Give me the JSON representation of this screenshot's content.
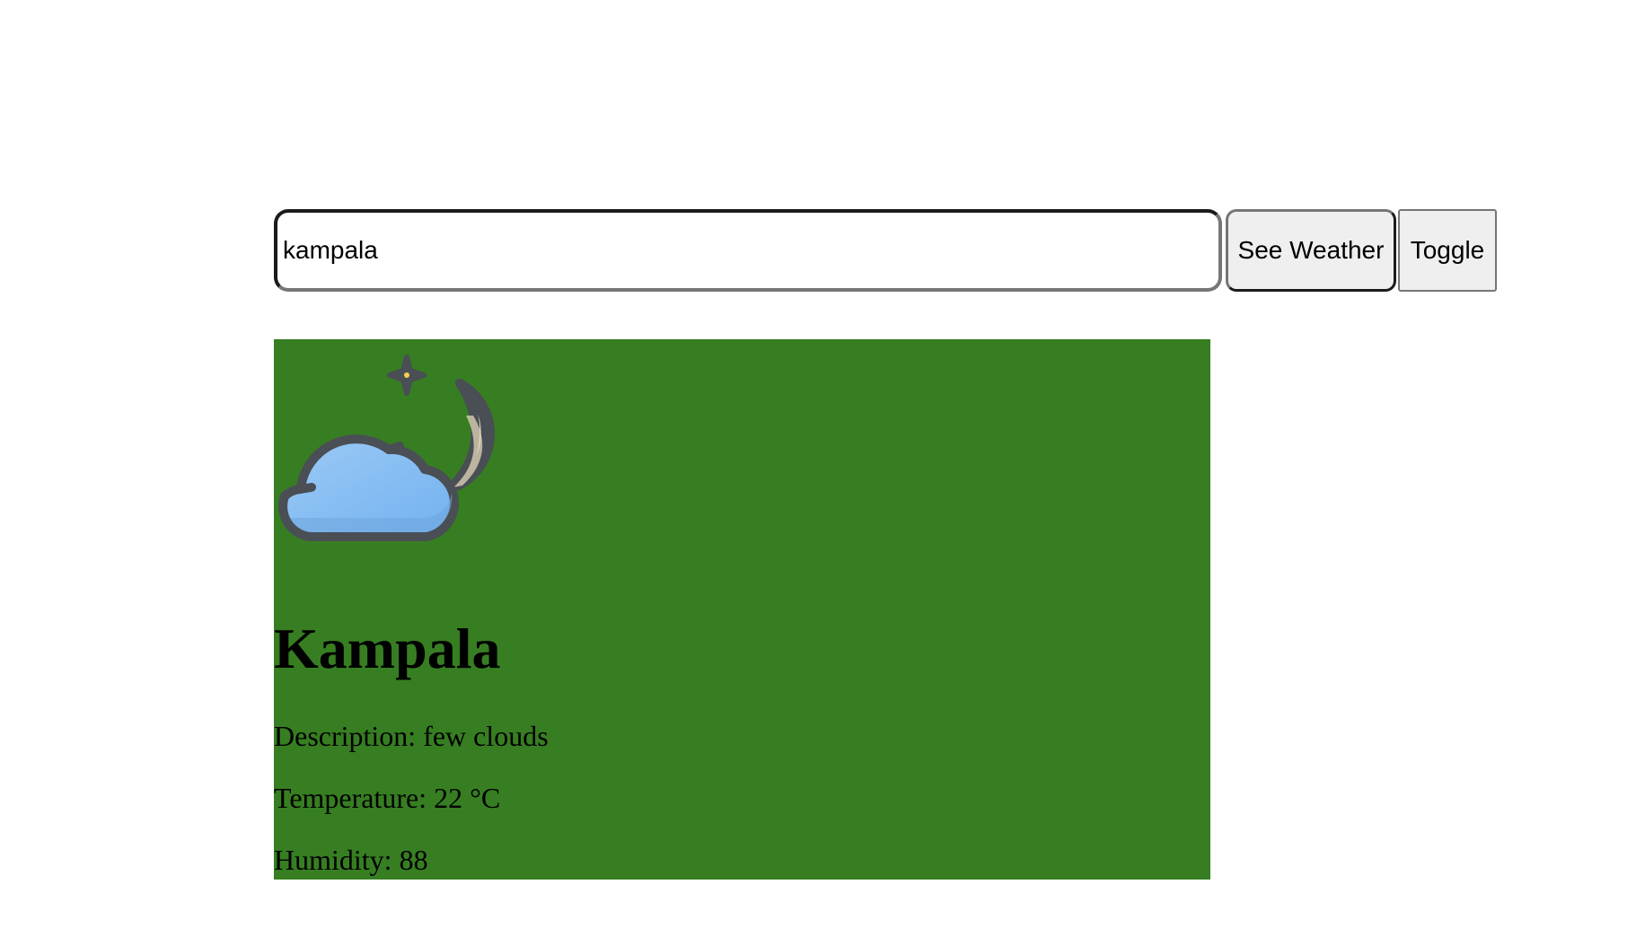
{
  "search": {
    "value": "kampala"
  },
  "buttons": {
    "see_weather": "See Weather",
    "toggle": "Toggle"
  },
  "weather": {
    "icon": "partly-cloudy-night-icon",
    "city": "Kampala",
    "description_label": "Description: ",
    "description": "few clouds",
    "temperature_label": "Temperature: ",
    "temperature": "22 °C",
    "humidity_label": "Humidity: ",
    "humidity": "88"
  },
  "colors": {
    "card_background": "#377e22",
    "button_background": "#efefef",
    "cloud": "#8cc0f2",
    "moon": "#fdf3d8",
    "icon_outline": "#4a4e55"
  }
}
